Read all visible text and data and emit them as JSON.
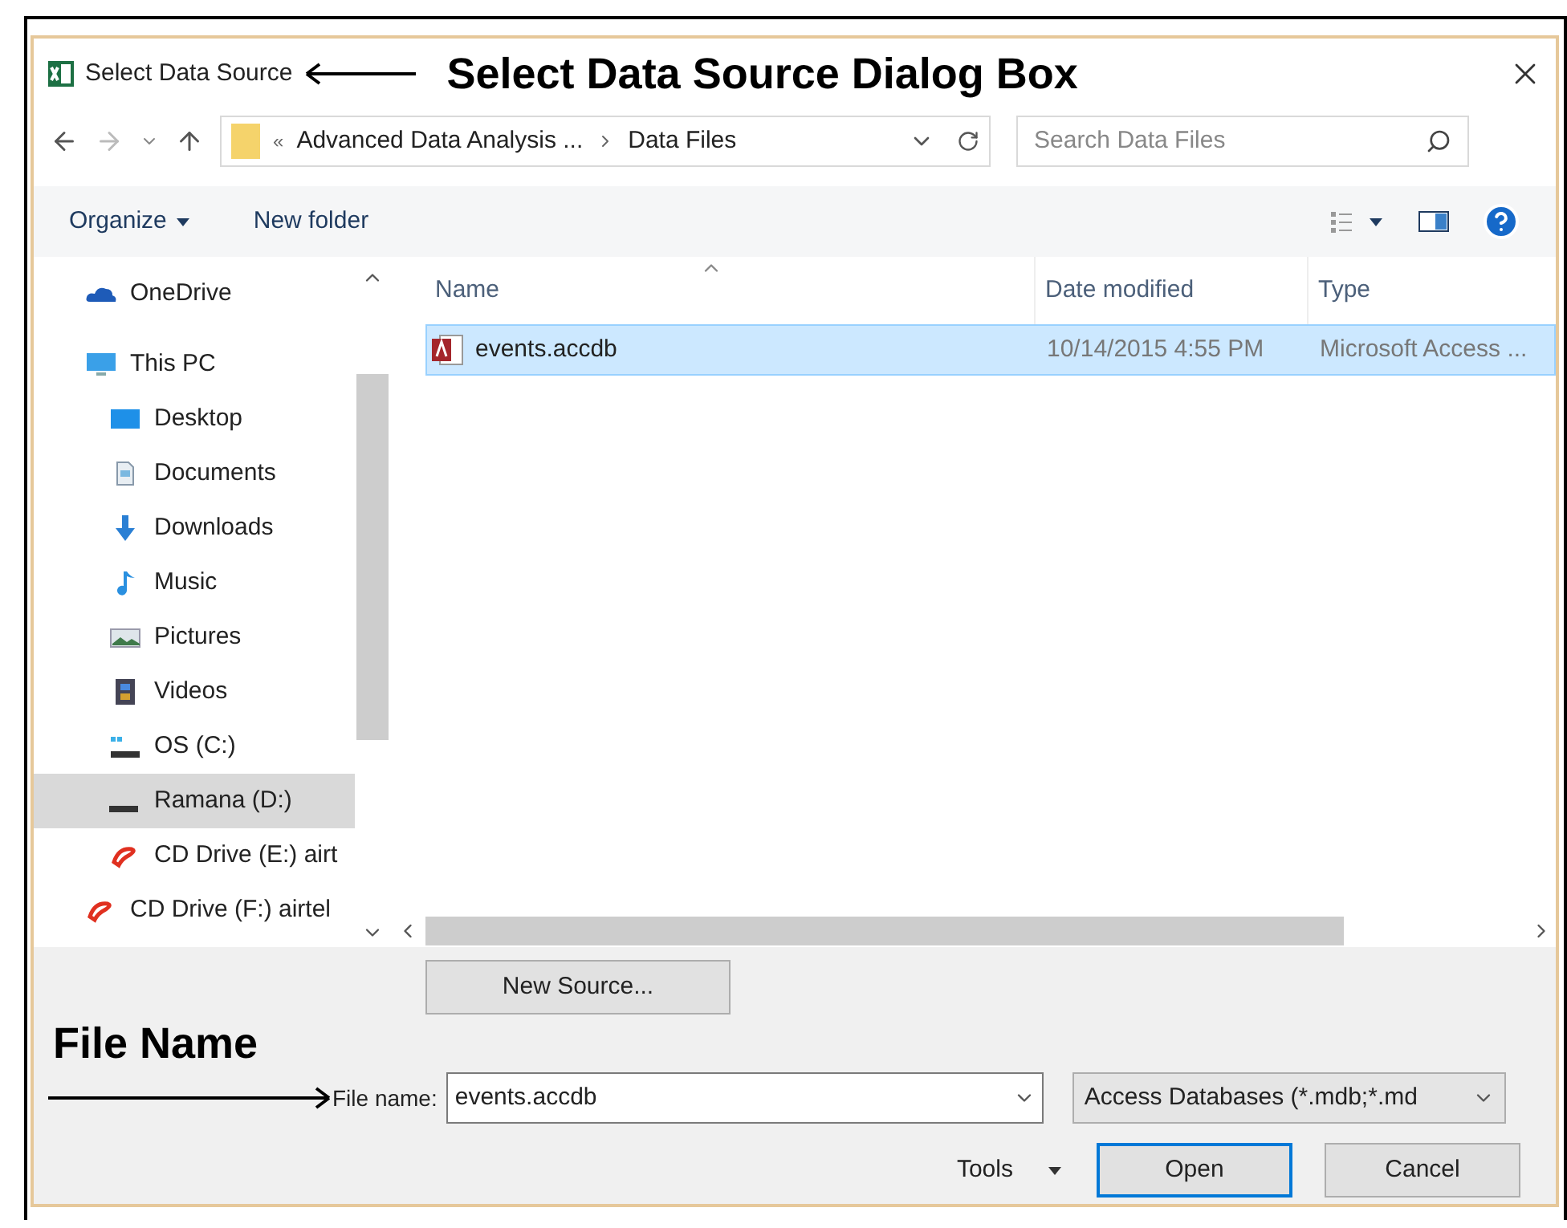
{
  "window": {
    "title": "Select Data Source"
  },
  "annotations": [
    {
      "text": "Select Data Source Dialog Box"
    },
    {
      "text": "File Name"
    }
  ],
  "address_bar": {
    "overflow": "«",
    "segments": [
      "Advanced Data Analysis ...",
      "Data Files"
    ]
  },
  "search": {
    "placeholder": "Search Data Files"
  },
  "toolbar": {
    "organize": "Organize",
    "new_folder": "New folder"
  },
  "sidebar": {
    "items": [
      {
        "label": "OneDrive",
        "kind": "cloud",
        "selected": false
      },
      {
        "label": "This PC",
        "kind": "pc",
        "selected": false,
        "children": [
          {
            "label": "Desktop",
            "kind": "desktop",
            "selected": false
          },
          {
            "label": "Documents",
            "kind": "document",
            "selected": false
          },
          {
            "label": "Downloads",
            "kind": "download",
            "selected": false
          },
          {
            "label": "Music",
            "kind": "music",
            "selected": false
          },
          {
            "label": "Pictures",
            "kind": "pictures",
            "selected": false
          },
          {
            "label": "Videos",
            "kind": "videos",
            "selected": false
          },
          {
            "label": "OS (C:)",
            "kind": "osdrive",
            "selected": false
          },
          {
            "label": "Ramana (D:)",
            "kind": "drive",
            "selected": true
          },
          {
            "label": "CD Drive (E:) airt",
            "kind": "cd",
            "selected": false
          }
        ]
      },
      {
        "label": "CD Drive (F:) airtel",
        "kind": "cd",
        "selected": false
      }
    ]
  },
  "file_list": {
    "columns": [
      "Name",
      "Date modified",
      "Type"
    ],
    "rows": [
      {
        "name": "events.accdb",
        "date": "10/14/2015 4:55 PM",
        "type": "Microsoft Access ...",
        "selected": true
      }
    ]
  },
  "new_source_button": "New Source...",
  "file_name": {
    "label": "File name:",
    "value": "events.accdb"
  },
  "filter": {
    "value": "Access Databases (*.mdb;*.md"
  },
  "tools": "Tools",
  "buttons": [
    {
      "label": "Open",
      "kind": "primary"
    },
    {
      "label": "Cancel",
      "kind": "normal"
    }
  ]
}
